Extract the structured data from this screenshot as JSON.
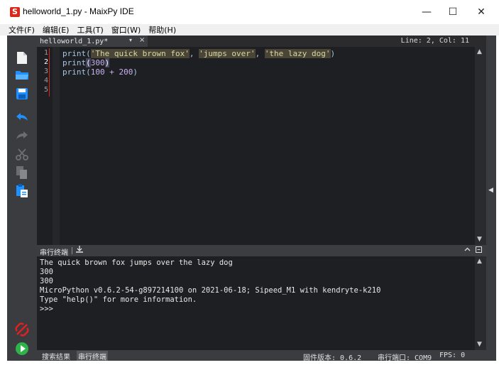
{
  "window": {
    "logo": "S",
    "title": "helloworld_1.py - MaixPy IDE",
    "minimize": "—",
    "maximize": "☐",
    "close": "✕"
  },
  "menu": [
    {
      "label": "文件(F)"
    },
    {
      "label": "编辑(E)"
    },
    {
      "label": "工具(T)"
    },
    {
      "label": "窗口(W)"
    },
    {
      "label": "帮助(H)"
    }
  ],
  "toolbar": {
    "icons": [
      "new-file-icon",
      "open-folder-icon",
      "save-icon",
      "undo-icon",
      "redo-icon",
      "cut-icon",
      "copy-icon",
      "paste-icon",
      "disconnect-icon",
      "run-icon"
    ]
  },
  "editor": {
    "tab_label": "helloworld_1.py*",
    "tab_dropdown": "▾",
    "tab_close": "×",
    "cursor_position": "Line: 2, Col: 11",
    "line_numbers": [
      "1",
      "2",
      "3",
      "4",
      "5"
    ],
    "lines": [
      {
        "fn": "print",
        "open": "(",
        "s1": "'The quick brown fox'",
        "c1": ", ",
        "s2": "'jumps over'",
        "c2": ", ",
        "s3": "'the lazy dog'",
        "close": ")"
      },
      {
        "fn": "print",
        "open": "(",
        "arg": "300",
        "close": ")"
      },
      {
        "fn": "print",
        "open": "(",
        "arg": "100 + 200",
        "close": ")"
      }
    ],
    "scroll_up": "▲",
    "scroll_down": "▼"
  },
  "terminal": {
    "title": "串行终端",
    "save_icon": "💾",
    "ctrl_collapse": "︿",
    "ctrl_close": "◘",
    "lines": [
      "The quick brown fox jumps over the lazy dog",
      "300",
      "300",
      "MicroPython v0.6.2-54-g897214100 on 2021-06-18; Sipeed_M1 with kendryte-k210",
      "Type \"help()\" for more information.",
      ">>>"
    ]
  },
  "statusbar": {
    "tab_search": "搜索结果",
    "tab_serial": "串行终端",
    "firmware": "固件版本: 0.6.2",
    "serial_port": "串行端口: COM9",
    "fps": "FPS: 0"
  },
  "right_strip": {
    "collapse": "◀"
  },
  "colors": {
    "toolbar_bg": "#3a3c40",
    "editor_bg": "#1e1f22",
    "accent_blue": "#1e90ff",
    "accent_green": "#2db34a",
    "accent_red": "#e0211f"
  }
}
